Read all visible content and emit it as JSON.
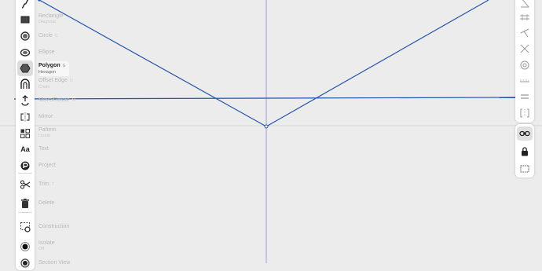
{
  "tools": [
    {
      "label": "Rectangle",
      "sub": "Diagonal",
      "key": "",
      "icon": "rectangle-icon",
      "state": "dim"
    },
    {
      "label": "Circle",
      "sub": "",
      "key": "C",
      "icon": "circle-icon",
      "state": "dim"
    },
    {
      "label": "Ellipse",
      "sub": "",
      "key": "",
      "icon": "ellipse-icon",
      "state": "dim"
    },
    {
      "label": "Polygon",
      "sub": "Hexagon",
      "key": "G",
      "icon": "polygon-icon",
      "state": "active"
    },
    {
      "label": "Offset Edge",
      "sub": "Chain",
      "key": "O",
      "icon": "offset-edge-icon",
      "state": "dim"
    },
    {
      "label": "Move/Rotate",
      "sub": "",
      "key": "M",
      "icon": "move-rotate-icon",
      "state": "dim"
    },
    {
      "label": "Mirror",
      "sub": "",
      "key": "",
      "icon": "mirror-icon",
      "state": "dim"
    },
    {
      "label": "Pattern",
      "sub": "Linear",
      "key": "",
      "icon": "pattern-icon",
      "state": "dim"
    },
    {
      "label": "Text",
      "sub": "",
      "key": "",
      "icon": "text-icon",
      "state": "dim"
    },
    {
      "label": "Project",
      "sub": "",
      "key": "",
      "icon": "project-icon",
      "state": "dim"
    },
    {
      "label": "Trim",
      "sub": "",
      "key": "T",
      "icon": "trim-icon",
      "state": "dim"
    },
    {
      "label": "Delete",
      "sub": "",
      "key": "",
      "icon": "delete-icon",
      "state": "dim"
    },
    {
      "label": "Construction",
      "sub": "",
      "key": "",
      "icon": "construction-icon",
      "state": "dim"
    },
    {
      "label": "Isolate",
      "sub": "Off",
      "key": "",
      "icon": "isolate-icon",
      "state": "dim"
    },
    {
      "label": "Section View",
      "sub": "",
      "key": "",
      "icon": "section-view-icon",
      "state": "dim"
    }
  ],
  "text_tool_glyph": "Aa",
  "constraints_top": [
    "angle-constraint-icon",
    "parallel-constraint-icon",
    "perpendicular-constraint-icon",
    "coincident-constraint-icon",
    "concentric-constraint-icon",
    "horizontal-constraint-icon",
    "equal-constraint-icon",
    "symmetric-constraint-icon"
  ],
  "constraints_bottom": [
    "link-icon",
    "lock-icon",
    "fix-dimension-icon"
  ],
  "colors": {
    "sketch_line": "#2255aa",
    "axis": "#8080d0",
    "canvas": "#ececec"
  }
}
